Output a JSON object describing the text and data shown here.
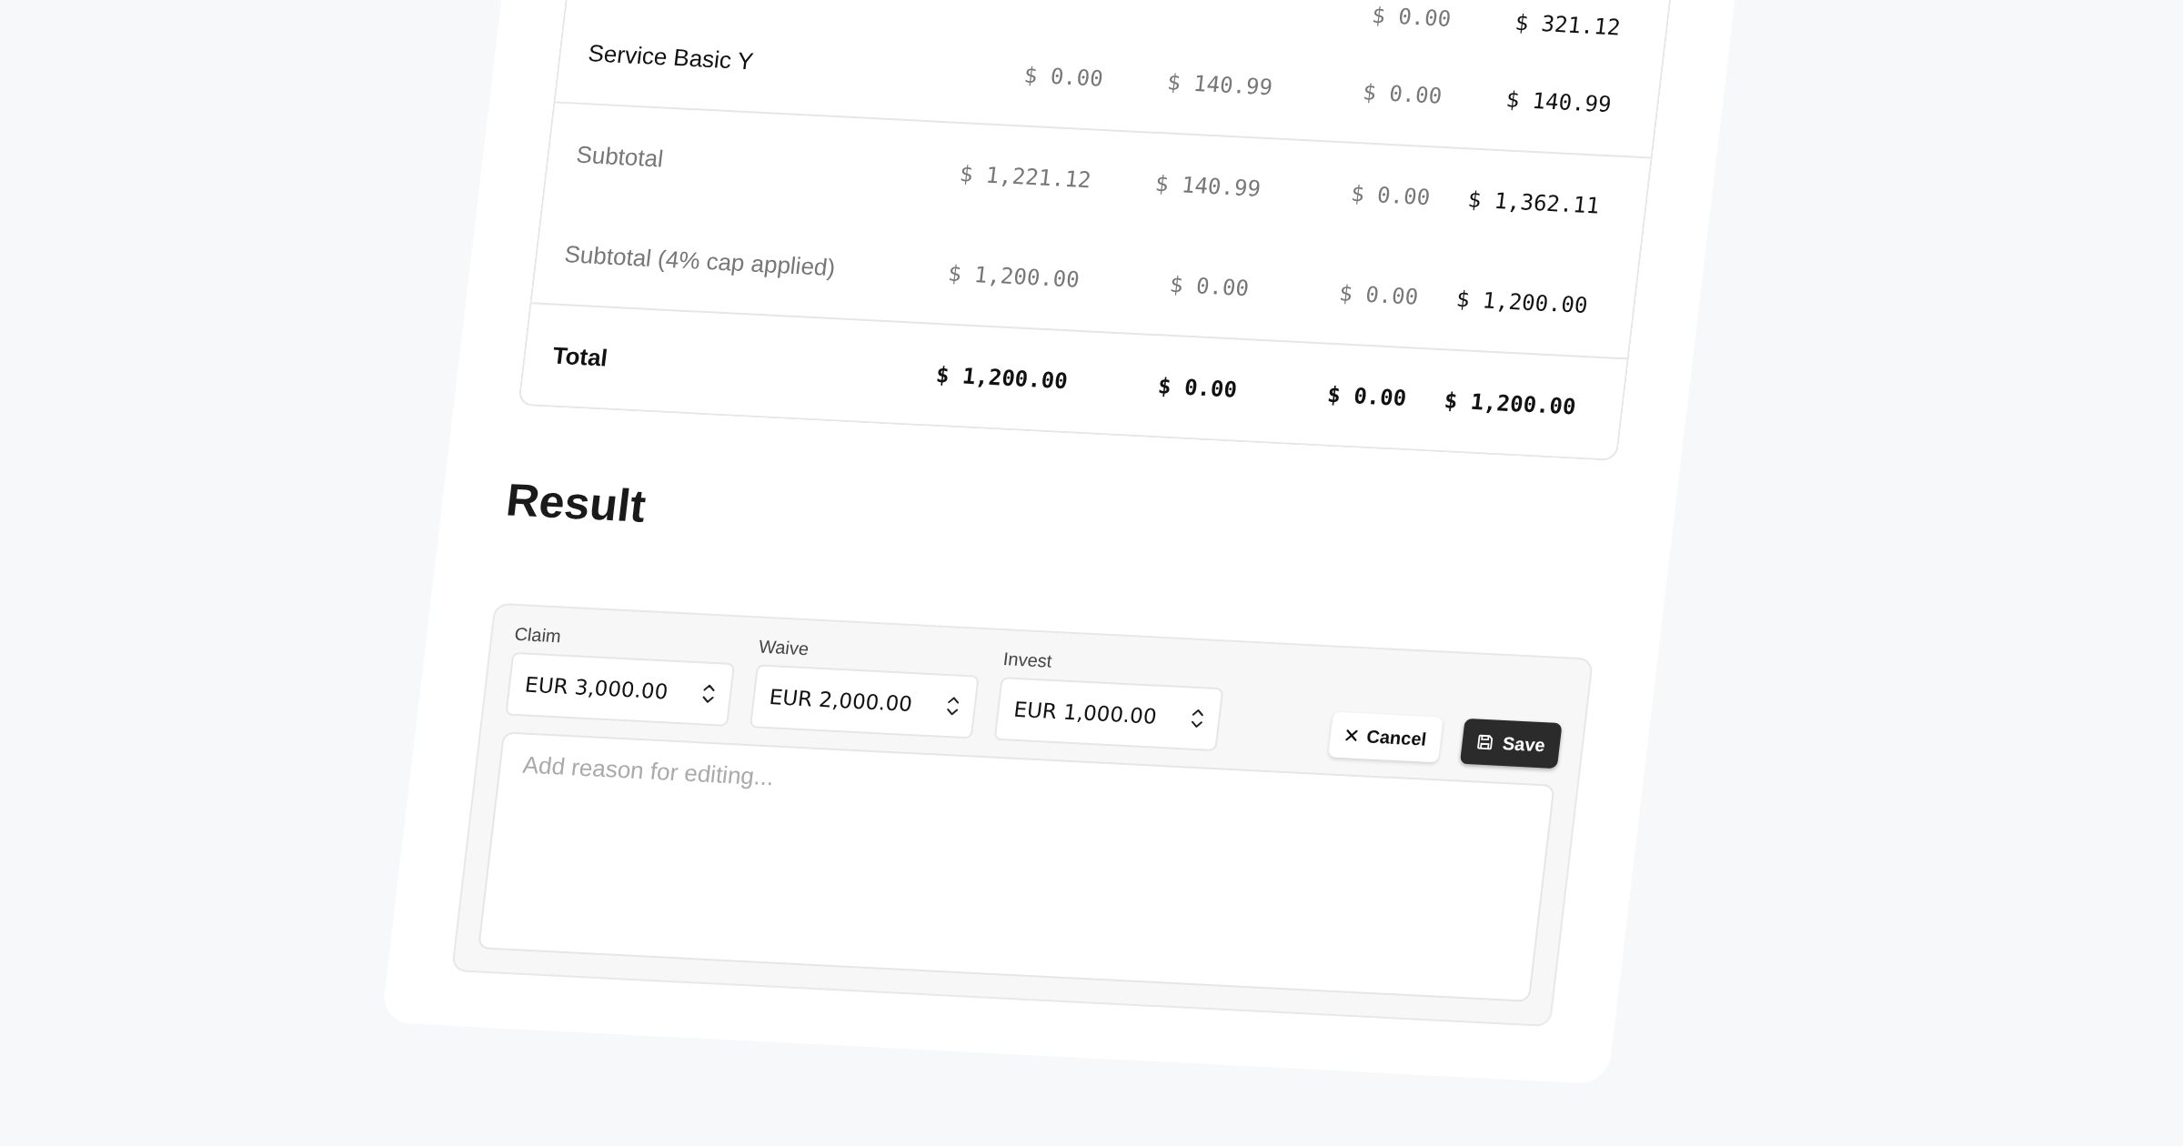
{
  "table": {
    "rows": [
      {
        "kind": "item",
        "column_4": "$ 0.00",
        "column_5": "$ 321.12"
      },
      {
        "kind": "item",
        "column_1": "Service Basic Y",
        "column_2": "$ 0.00",
        "column_3": "$ 140.99",
        "column_4": "$ 0.00",
        "column_5": "$ 140.99"
      },
      {
        "kind": "subtotal",
        "column_1": "Subtotal",
        "column_2": "$ 1,221.12",
        "column_3": "$ 140.99",
        "column_4": "$ 0.00",
        "column_5": "$ 1,362.11"
      },
      {
        "kind": "subtotal",
        "column_1": "Subtotal (4% cap applied)",
        "column_2": "$ 1,200.00",
        "column_3": "$ 0.00",
        "column_4": "$ 0.00",
        "column_5": "$ 1,200.00"
      },
      {
        "kind": "total",
        "column_1": "Total",
        "column_2": "$ 1,200.00",
        "column_3": "$ 0.00",
        "column_4": "$ 0.00",
        "column_5": "$ 1,200.00"
      }
    ]
  },
  "result": {
    "heading": "Result",
    "fields": [
      {
        "label": "Claim",
        "value": "EUR 3,000.00"
      },
      {
        "label": "Waive",
        "value": "EUR 2,000.00"
      },
      {
        "label": "Invest",
        "value": "EUR 1,000.00"
      }
    ],
    "buttons": [
      {
        "kind": "cancel",
        "label": "Cancel"
      },
      {
        "kind": "save",
        "label": "Save"
      }
    ],
    "reason": {
      "placeholder": "Add reason for editing..."
    }
  }
}
